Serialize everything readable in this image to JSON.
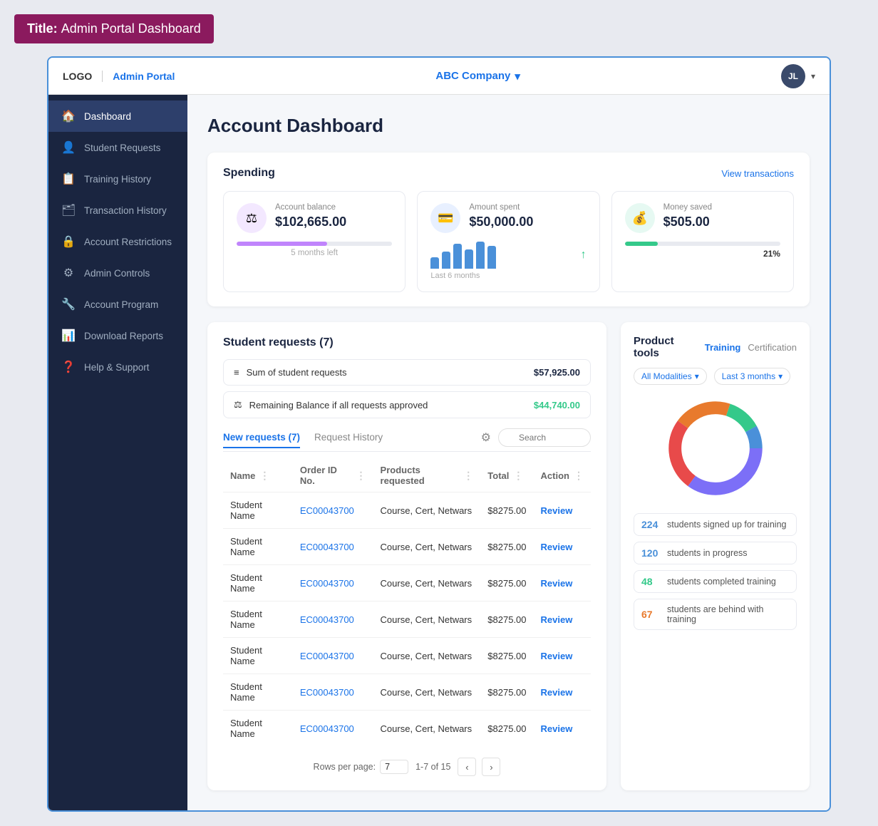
{
  "titleBar": {
    "prefix": "Title:",
    "title": "Admin Portal Dashboard"
  },
  "topNav": {
    "logo": "LOGO",
    "portalLabel": "Admin Portal",
    "companyName": "ABC Company",
    "userInitials": "JL"
  },
  "sidebar": {
    "items": [
      {
        "id": "dashboard",
        "label": "Dashboard",
        "icon": "🏠",
        "active": true
      },
      {
        "id": "student-requests",
        "label": "Student Requests",
        "icon": "👤"
      },
      {
        "id": "training-history",
        "label": "Training History",
        "icon": "📋"
      },
      {
        "id": "transaction-history",
        "label": "Transaction History",
        "icon": "🗂"
      },
      {
        "id": "account-restrictions",
        "label": "Account Restrictions",
        "icon": "🔒"
      },
      {
        "id": "admin-controls",
        "label": "Admin Controls",
        "icon": "⚙"
      },
      {
        "id": "account-program",
        "label": "Account Program",
        "icon": "🔧"
      },
      {
        "id": "download-reports",
        "label": "Download Reports",
        "icon": "📊"
      },
      {
        "id": "help-support",
        "label": "Help & Support",
        "icon": "❓"
      }
    ]
  },
  "pageTitle": "Account Dashboard",
  "spending": {
    "sectionTitle": "Spending",
    "viewTransactions": "View transactions",
    "cards": [
      {
        "label": "Account balance",
        "value": "$102,665.00",
        "subText": "5 months left",
        "iconSymbol": "⚖",
        "iconClass": "icon-purple",
        "subType": "progress",
        "progressValue": 58
      },
      {
        "label": "Amount spent",
        "value": "$50,000.00",
        "subText": "Last 6 months",
        "iconSymbol": "💳",
        "iconClass": "icon-blue",
        "subType": "barchart",
        "bars": [
          25,
          38,
          55,
          42,
          60,
          50
        ]
      },
      {
        "label": "Money saved",
        "value": "$505.00",
        "iconSymbol": "💰",
        "iconClass": "icon-green",
        "subType": "progress-percent",
        "progressValue": 21,
        "percentLabel": "21%"
      }
    ]
  },
  "studentRequests": {
    "sectionTitle": "Student requests (7)",
    "summaryRows": [
      {
        "icon": "≡",
        "label": "Sum of student requests",
        "amount": "$57,925.00",
        "amountClass": "amount"
      },
      {
        "icon": "⚖",
        "label": "Remaining Balance if all requests approved",
        "amount": "$44,740.00",
        "amountClass": "amount-green"
      }
    ],
    "tabs": [
      {
        "label": "New requests (7)",
        "active": true
      },
      {
        "label": "Request History",
        "active": false
      }
    ],
    "searchPlaceholder": "Search",
    "tableHeaders": [
      "Name",
      "Order ID No.",
      "Products requested",
      "Total",
      "Action"
    ],
    "tableRows": [
      {
        "name": "Student Name",
        "orderId": "EC00043700",
        "products": "Course, Cert, Netwars",
        "total": "$8275.00",
        "action": "Review"
      },
      {
        "name": "Student Name",
        "orderId": "EC00043700",
        "products": "Course, Cert, Netwars",
        "total": "$8275.00",
        "action": "Review"
      },
      {
        "name": "Student Name",
        "orderId": "EC00043700",
        "products": "Course, Cert, Netwars",
        "total": "$8275.00",
        "action": "Review"
      },
      {
        "name": "Student Name",
        "orderId": "EC00043700",
        "products": "Course, Cert, Netwars",
        "total": "$8275.00",
        "action": "Review"
      },
      {
        "name": "Student Name",
        "orderId": "EC00043700",
        "products": "Course, Cert, Netwars",
        "total": "$8275.00",
        "action": "Review"
      },
      {
        "name": "Student Name",
        "orderId": "EC00043700",
        "products": "Course, Cert, Netwars",
        "total": "$8275.00",
        "action": "Review"
      },
      {
        "name": "Student Name",
        "orderId": "EC00043700",
        "products": "Course, Cert, Netwars",
        "total": "$8275.00",
        "action": "Review"
      }
    ],
    "pagination": {
      "rowsPerPageLabel": "Rows per page:",
      "rowsPerPageValue": "7",
      "pageInfo": "1-7 of 15"
    }
  },
  "productTools": {
    "title": "Product tools",
    "tabs": [
      {
        "label": "Training",
        "active": true
      },
      {
        "label": "Certification",
        "active": false
      }
    ],
    "filters": [
      {
        "label": "All Modalities"
      },
      {
        "label": "Last 3 months"
      }
    ],
    "donut": {
      "segments": [
        {
          "color": "#7c6ff7",
          "pct": 35
        },
        {
          "color": "#e84a4a",
          "pct": 25
        },
        {
          "color": "#e87a2d",
          "pct": 20
        },
        {
          "color": "#34c98a",
          "pct": 12
        },
        {
          "color": "#4a90d9",
          "pct": 8
        }
      ]
    },
    "stats": [
      {
        "num": "224",
        "numClass": "num-blue",
        "label": "students signed up for training"
      },
      {
        "num": "120",
        "numClass": "num-blue",
        "label": "students in progress"
      },
      {
        "num": "48",
        "numClass": "num-green",
        "label": "students completed training"
      },
      {
        "num": "67",
        "numClass": "num-orange",
        "label": "students are behind with training"
      }
    ]
  }
}
